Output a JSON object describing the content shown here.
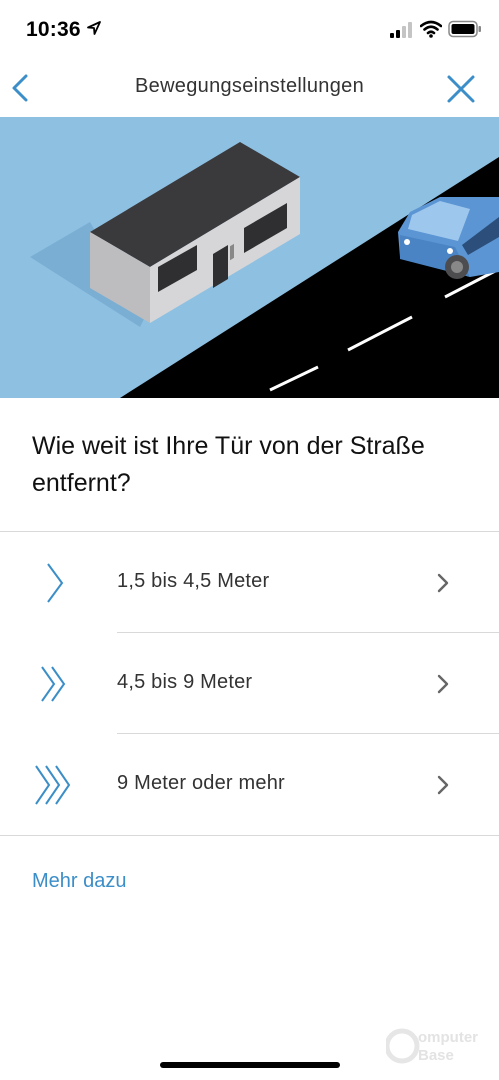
{
  "status_bar": {
    "time": "10:36",
    "icons": [
      "location-arrow-icon",
      "cellular-signal-icon",
      "wifi-icon",
      "battery-icon"
    ]
  },
  "nav": {
    "title": "Bewegungseinstellungen",
    "back_icon": "chevron-left-icon",
    "close_icon": "close-icon"
  },
  "question": "Wie weit ist Ihre Tür von der Straße entfernt?",
  "options": [
    {
      "label": "1,5 bis 4,5 Meter",
      "icon": "single-chevron-icon"
    },
    {
      "label": "4,5 bis 9 Meter",
      "icon": "double-chevron-icon"
    },
    {
      "label": "9 Meter oder mehr",
      "icon": "triple-chevron-icon"
    }
  ],
  "more_link": "Mehr dazu",
  "watermark": {
    "line1": "Computer",
    "line2": "Base"
  },
  "colors": {
    "accent": "#3c8ec8",
    "sky": "#8ec0e2",
    "road": "#000000",
    "van": "#5b95d3",
    "roof": "#3a393c",
    "wall": "#d6d6d8",
    "divider": "#d9d9d9"
  }
}
